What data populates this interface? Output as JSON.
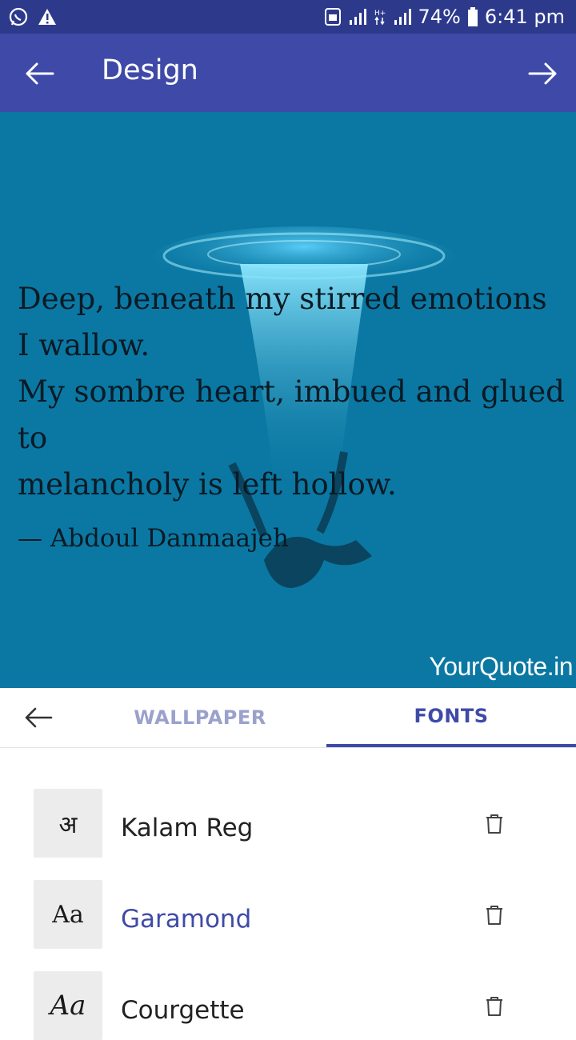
{
  "status_bar": {
    "battery": "74%",
    "time": "6:41 pm",
    "icons": [
      "whatsapp-icon",
      "warning-icon",
      "sim-icon",
      "signal-icon",
      "data-icon",
      "signal-icon",
      "battery-icon"
    ]
  },
  "app_bar": {
    "title": "Design",
    "back_icon": "arrow-left-icon",
    "forward_icon": "arrow-right-icon"
  },
  "quote": {
    "text": "Deep, beneath my stirred emotions\nI wallow.\nMy sombre heart, imbued and glued to\nmelancholy is left hollow.",
    "author": "— Abdoul Danmaajeh",
    "watermark": "YourQuote.in",
    "background_color": "#0a78a3"
  },
  "tabs": {
    "wallpaper": "WALLPAPER",
    "fonts": "FONTS",
    "active": "fonts"
  },
  "fonts": [
    {
      "thumb": "अ",
      "name": "Kalam Reg",
      "selected": false
    },
    {
      "thumb": "Aa",
      "name": "Garamond",
      "selected": true
    },
    {
      "thumb": "Aa",
      "name": "Courgette",
      "selected": false
    }
  ],
  "colors": {
    "primary": "#3f4aa8",
    "status_bar": "#2d3a8c",
    "inactive_tab": "#9aa1cc"
  }
}
